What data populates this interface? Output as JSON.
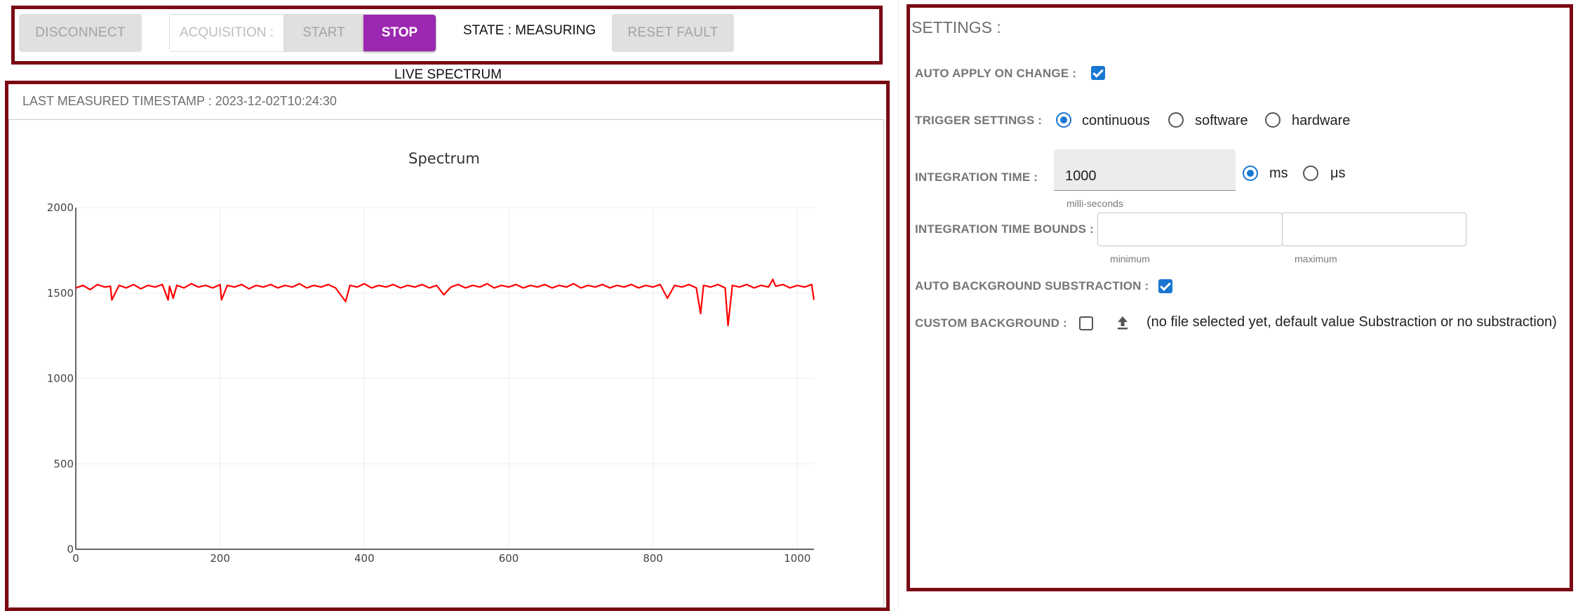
{
  "toolbar": {
    "disconnect_label": "DISCONNECT",
    "acquisition_label": "ACQUISITION :",
    "start_label": "START",
    "stop_label": "STOP",
    "state_text": "STATE : MEASURING",
    "reset_fault_label": "RESET FAULT"
  },
  "spectrum": {
    "section_title": "LIVE SPECTRUM",
    "timestamp_text": "LAST MEASURED TIMESTAMP : 2023-12-02T10:24:30"
  },
  "chart_data": {
    "type": "line",
    "title": "Spectrum",
    "xlabel": "",
    "ylabel": "",
    "xlim": [
      0,
      1023
    ],
    "ylim": [
      0,
      2000
    ],
    "x_ticks": [
      0,
      200,
      400,
      600,
      800,
      1000
    ],
    "y_ticks": [
      0,
      500,
      1000,
      1500,
      2000
    ],
    "grid": true,
    "color": "#ff0000",
    "series": [
      {
        "x": [
          0,
          10,
          20,
          30,
          40,
          48,
          50,
          60,
          70,
          80,
          90,
          100,
          110,
          120,
          128,
          130,
          135,
          140,
          150,
          160,
          170,
          180,
          190,
          200,
          202,
          210,
          220,
          230,
          240,
          250,
          260,
          270,
          280,
          290,
          300,
          310,
          320,
          330,
          340,
          350,
          360,
          374,
          380,
          390,
          400,
          410,
          420,
          430,
          440,
          450,
          460,
          470,
          480,
          490,
          500,
          510,
          520,
          530,
          540,
          550,
          560,
          570,
          580,
          590,
          600,
          610,
          620,
          630,
          640,
          650,
          660,
          670,
          680,
          690,
          700,
          710,
          720,
          730,
          740,
          750,
          760,
          770,
          780,
          790,
          800,
          810,
          820,
          830,
          840,
          850,
          860,
          866,
          870,
          880,
          890,
          900,
          904,
          910,
          920,
          930,
          940,
          950,
          960,
          966,
          970,
          980,
          990,
          1000,
          1010,
          1020,
          1023
        ],
        "y": [
          1530,
          1545,
          1520,
          1550,
          1535,
          1540,
          1460,
          1545,
          1530,
          1550,
          1525,
          1545,
          1535,
          1550,
          1460,
          1540,
          1470,
          1545,
          1530,
          1555,
          1535,
          1545,
          1530,
          1550,
          1460,
          1545,
          1535,
          1550,
          1525,
          1545,
          1535,
          1550,
          1530,
          1545,
          1535,
          1555,
          1530,
          1545,
          1535,
          1550,
          1530,
          1450,
          1545,
          1535,
          1555,
          1530,
          1545,
          1535,
          1550,
          1530,
          1545,
          1535,
          1550,
          1530,
          1545,
          1490,
          1535,
          1550,
          1530,
          1545,
          1535,
          1555,
          1530,
          1545,
          1535,
          1550,
          1530,
          1545,
          1535,
          1550,
          1530,
          1545,
          1535,
          1555,
          1530,
          1545,
          1535,
          1550,
          1530,
          1545,
          1535,
          1550,
          1530,
          1545,
          1535,
          1550,
          1470,
          1545,
          1535,
          1550,
          1530,
          1380,
          1545,
          1535,
          1550,
          1530,
          1310,
          1545,
          1535,
          1550,
          1530,
          1545,
          1535,
          1580,
          1540,
          1550,
          1530,
          1545,
          1535,
          1550,
          1460
        ]
      }
    ]
  },
  "settings": {
    "title": "SETTINGS :",
    "auto_apply_label": "AUTO APPLY ON CHANGE :",
    "auto_apply_checked": true,
    "trigger_label": "TRIGGER SETTINGS :",
    "trigger_options": [
      "continuous",
      "software",
      "hardware"
    ],
    "trigger_selected": "continuous",
    "integration_label": "INTEGRATION TIME :",
    "integration_value": "1000",
    "integration_helper": "milli-seconds",
    "unit_options": [
      "ms",
      "μs"
    ],
    "unit_selected": "ms",
    "bounds_label": "INTEGRATION TIME BOUNDS :",
    "bounds_min_helper": "minimum",
    "bounds_max_helper": "maximum",
    "bounds_min_value": "",
    "bounds_max_value": "",
    "auto_bg_label": "AUTO BACKGROUND SUBSTRACTION :",
    "auto_bg_checked": true,
    "custom_bg_label": "CUSTOM BACKGROUND :",
    "custom_bg_checked": false,
    "custom_bg_note": "(no file selected yet, default value Substraction or no substraction)"
  }
}
